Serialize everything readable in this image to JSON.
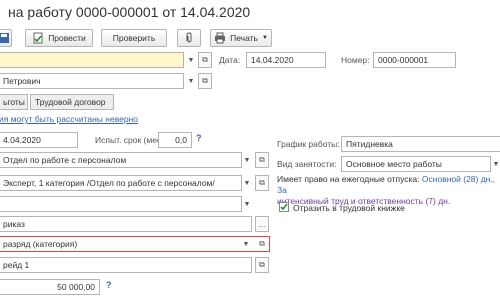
{
  "title": "на работу 0000-000001 от 14.04.2020",
  "toolbar": {
    "post_label": "Провести",
    "check_label": "Проверить",
    "print_label": "Печать"
  },
  "header": {
    "date_label": "Дата:",
    "date_value": "14.04.2020",
    "number_label": "Номер:",
    "number_value": "0000-000001",
    "employee_value": "Петрович"
  },
  "tabs": [
    "ьготы",
    "Трудовой договор"
  ],
  "warning_link": "ия могут быть рассчитаны неверно",
  "left": {
    "start_date": "4.04.2020",
    "probation_label": "Испыт. срок (мес):",
    "probation_value": "0,0",
    "department": "Отдел по работе с персоналом",
    "position": "Эксперт, 1 категория /Отдел по работе с персоналом/",
    "empty_field": "",
    "order_value": "риказ",
    "category_value": "разряд (категория)",
    "grade_value": "рейд 1",
    "amount_value": "50 000,00"
  },
  "right": {
    "schedule_label": "График работы:",
    "schedule_value": "Пятидневка",
    "employment_label": "Вид занятости:",
    "employment_value": "Основное место работы",
    "leave_label": "Имеет право на ежегодные отпуска:",
    "leave_link1": "Основной (28) дн.,",
    "leave_link2": "За",
    "leave_link3": "интенсивный труд и ответственность (7) дн.",
    "reflect_label": "Отразить в трудовой книжке",
    "reflect_checked": true
  },
  "icons": {
    "save": "save-icon",
    "post": "post-document-icon",
    "attach": "paperclip-icon",
    "print": "printer-icon",
    "open": "open-form-icon",
    "dropdown": "chevron-down-icon",
    "help": "help-icon",
    "checkbox": "checkbox-icon"
  },
  "colors": {
    "highlight_red": "#d94444",
    "link_blue": "#3a66a8",
    "purple_text": "#6d3f99",
    "yellow_field": "#fff7c9",
    "green_check": "#2e8b3a"
  }
}
